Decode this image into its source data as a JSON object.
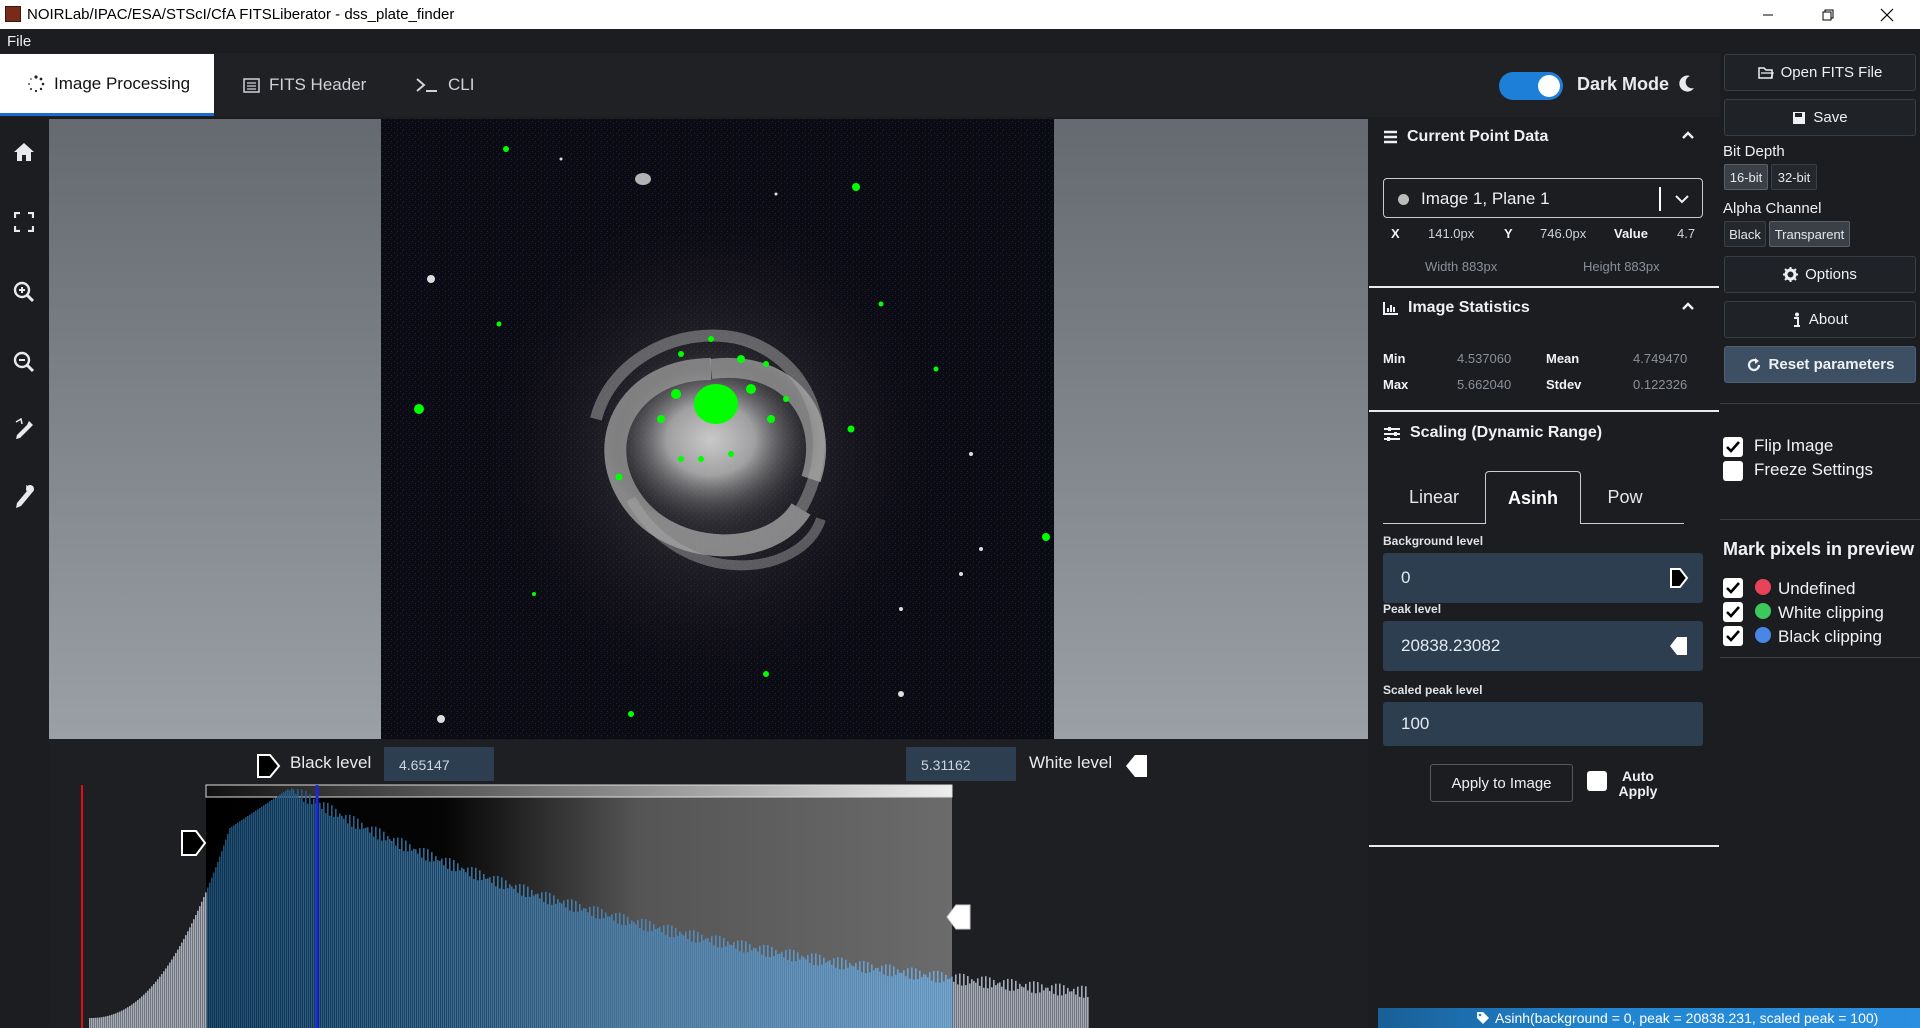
{
  "window": {
    "title": "NOIRLab/IPAC/ESA/STScI/CfA FITSLiberator - dss_plate_finder"
  },
  "menu": {
    "file": "File"
  },
  "tabs": [
    {
      "label": "Image Processing"
    },
    {
      "label": "FITS Header"
    },
    {
      "label": "CLI"
    }
  ],
  "dark_mode": {
    "label": "Dark Mode",
    "on": true
  },
  "histogram": {
    "black_label": "Black level",
    "black_value": "4.65147",
    "white_label": "White level",
    "white_value": "5.31162"
  },
  "point_data": {
    "title": "Current Point Data",
    "plane": "Image 1, Plane 1",
    "x_label": "X",
    "x_value": "141.0px",
    "y_label": "Y",
    "y_value": "746.0px",
    "value_label": "Value",
    "value": "4.7",
    "width": "Width 883px",
    "height": "Height 883px"
  },
  "stats": {
    "title": "Image Statistics",
    "min_label": "Min",
    "min": "4.537060",
    "mean_label": "Mean",
    "mean": "4.749470",
    "max_label": "Max",
    "max": "5.662040",
    "stdev_label": "Stdev",
    "stdev": "0.122326"
  },
  "scaling": {
    "title": "Scaling (Dynamic Range)",
    "tabs": [
      "Linear",
      "Asinh",
      "Pow"
    ],
    "active": "Asinh",
    "bg_label": "Background level",
    "bg_value": "0",
    "peak_label": "Peak level",
    "peak_value": "20838.23082",
    "scaled_label": "Scaled peak level",
    "scaled_value": "100",
    "apply": "Apply to Image",
    "auto_apply": "Auto Apply"
  },
  "sidebar": {
    "open": "Open FITS File",
    "save": "Save",
    "bit_depth": "Bit Depth",
    "bit16": "16-bit",
    "bit32": "32-bit",
    "alpha": "Alpha Channel",
    "black": "Black",
    "transparent": "Transparent",
    "options": "Options",
    "about": "About",
    "reset": "Reset parameters",
    "flip": "Flip Image",
    "freeze": "Freeze Settings",
    "mark_title": "Mark pixels in preview",
    "undefined": "Undefined",
    "white_clip": "White clipping",
    "black_clip": "Black clipping"
  },
  "status": {
    "text": "Asinh(background = 0, peak = 20838.231, scaled peak = 100)"
  },
  "colors": {
    "accent": "#1d7fd8",
    "undefined": "#e8435a",
    "white_clip": "#3cc85a",
    "black_clip": "#4a86e8",
    "clip_marker": "#00ff00"
  }
}
